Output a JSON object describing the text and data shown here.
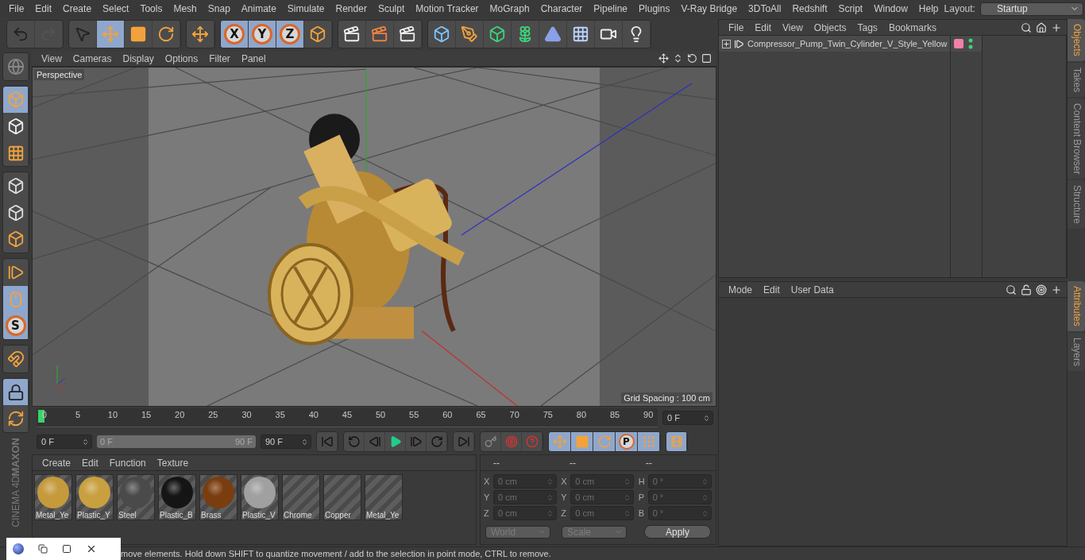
{
  "menu_bar": {
    "items": [
      "File",
      "Edit",
      "Create",
      "Select",
      "Tools",
      "Mesh",
      "Snap",
      "Animate",
      "Simulate",
      "Render",
      "Sculpt",
      "Motion Tracker",
      "MoGraph",
      "Character",
      "Pipeline",
      "Plugins",
      "V-Ray Bridge",
      "3DToAll",
      "Redshift",
      "Script",
      "Window",
      "Help"
    ],
    "layout_label": "Layout:",
    "layout_value": "Startup"
  },
  "main_toolbar": {
    "groups": [
      {
        "tools": [
          {
            "selected": false,
            "disabled": false
          },
          {
            "selected": false,
            "disabled": true
          }
        ]
      },
      {
        "tools": [
          {
            "selected": false
          },
          {
            "selected": true
          },
          {
            "selected": false
          },
          {
            "selected": false
          }
        ]
      },
      {
        "tools": [
          {
            "selected": false
          }
        ]
      },
      {
        "tools": [
          {
            "label": "X",
            "selected": true
          },
          {
            "label": "Y",
            "selected": true
          },
          {
            "label": "Z",
            "selected": true
          },
          {
            "selected": false
          }
        ]
      },
      {
        "tools": [
          {
            "selected": false
          },
          {
            "selected": false
          },
          {
            "selected": false
          }
        ]
      },
      {
        "tools": [
          {
            "selected": false
          },
          {
            "selected": false
          },
          {
            "selected": false
          },
          {
            "selected": false
          },
          {
            "selected": false
          },
          {
            "selected": false
          },
          {
            "selected": false
          },
          {
            "selected": false
          }
        ]
      }
    ]
  },
  "left_toolbar": {
    "groups": [
      {
        "tools": [
          {
            "selected": false
          }
        ]
      },
      {
        "tools": [
          {
            "selected": true
          },
          {
            "selected": false
          },
          {
            "selected": false
          }
        ]
      },
      {
        "tools": [
          {
            "selected": false
          },
          {
            "selected": false
          },
          {
            "selected": false
          }
        ]
      },
      {
        "tools": [
          {
            "selected": false
          },
          {
            "selected": true
          },
          {
            "label": "S",
            "selected": true
          }
        ]
      },
      {
        "tools": [
          {
            "selected": false
          }
        ]
      },
      {
        "tools": [
          {
            "selected": true
          },
          {
            "selected": false
          }
        ]
      }
    ]
  },
  "branding": [
    "MAXON",
    "CINEMA 4D"
  ],
  "viewport": {
    "menu": [
      "View",
      "Cameras",
      "Display",
      "Options",
      "Filter",
      "Panel"
    ],
    "camera": "Perspective",
    "grid_info": "Grid Spacing : 100 cm"
  },
  "timeline": {
    "labels": [
      "0",
      "5",
      "10",
      "15",
      "20",
      "25",
      "30",
      "35",
      "40",
      "45",
      "50",
      "55",
      "60",
      "65",
      "70",
      "75",
      "80",
      "85",
      "90"
    ],
    "level": 0,
    "frame_field": "0 F"
  },
  "transport": {
    "start_field": "0 F",
    "range_start": "0 F",
    "range_end": "90 F",
    "level": 1,
    "end_field": "90 F",
    "key_tools": [
      {
        "selected": true
      },
      {
        "selected": true
      },
      {
        "selected": true
      },
      {
        "label": "P",
        "selected": true
      },
      {
        "selected": true
      }
    ],
    "timeline_button": {
      "selected": true
    }
  },
  "materials": {
    "menu": [
      "Create",
      "Edit",
      "Function",
      "Texture"
    ],
    "items": [
      {
        "name": "Metal_Ye",
        "kind": "sphere",
        "color": "#c49a3c"
      },
      {
        "name": "Plastic_Y",
        "kind": "sphere",
        "color": "#c9a040"
      },
      {
        "name": "Steel",
        "kind": "sphere",
        "color": "#4a4a4a"
      },
      {
        "name": "Plastic_B",
        "kind": "sphere",
        "color": "#151515"
      },
      {
        "name": "Brass",
        "kind": "sphere",
        "color": "#7a3d10"
      },
      {
        "name": "Plastic_V",
        "kind": "sphere",
        "color": "#a0a0a0"
      },
      {
        "name": "Chrome",
        "kind": "empty"
      },
      {
        "name": "Copper",
        "kind": "empty"
      },
      {
        "name": "Metal_Ye",
        "kind": "empty"
      }
    ]
  },
  "coordinates": {
    "headers": [
      "--",
      "--",
      "--"
    ],
    "columns": [
      {
        "rows": [
          {
            "label": "X",
            "value": "0 cm"
          },
          {
            "label": "Y",
            "value": "0 cm"
          },
          {
            "label": "Z",
            "value": "0 cm"
          }
        ]
      },
      {
        "rows": [
          {
            "label": "X",
            "value": "0 cm"
          },
          {
            "label": "Y",
            "value": "0 cm"
          },
          {
            "label": "Z",
            "value": "0 cm"
          }
        ]
      },
      {
        "rows": [
          {
            "label": "H",
            "value": "0 °"
          },
          {
            "label": "P",
            "value": "0 °"
          },
          {
            "label": "B",
            "value": "0 °"
          }
        ]
      }
    ],
    "dropdowns": [
      {
        "value": "World",
        "disabled": true
      },
      {
        "value": "Scale",
        "disabled": true
      }
    ],
    "apply": "Apply"
  },
  "objects_panel": {
    "menu": [
      "File",
      "Edit",
      "View",
      "Objects",
      "Tags",
      "Bookmarks"
    ],
    "objects": [
      {
        "name": "Compressor_Pump_Twin_Cylinder_V_Style_Yellow",
        "expanded": false
      }
    ]
  },
  "attributes_panel": {
    "menu": [
      "Mode",
      "Edit",
      "User Data"
    ]
  },
  "side_tabs_top": [
    {
      "label": "Objects",
      "selected": true
    },
    {
      "label": "Takes",
      "selected": false
    },
    {
      "label": "Content Browser",
      "selected": false
    },
    {
      "label": "Structure",
      "selected": false
    }
  ],
  "side_tabs_bottom": [
    {
      "label": "Attributes",
      "selected": true
    },
    {
      "label": "Layers",
      "selected": false
    }
  ],
  "status_bar": {
    "text": "move elements. Hold down SHIFT to quantize movement / add to the selection in point mode, CTRL to remove."
  }
}
